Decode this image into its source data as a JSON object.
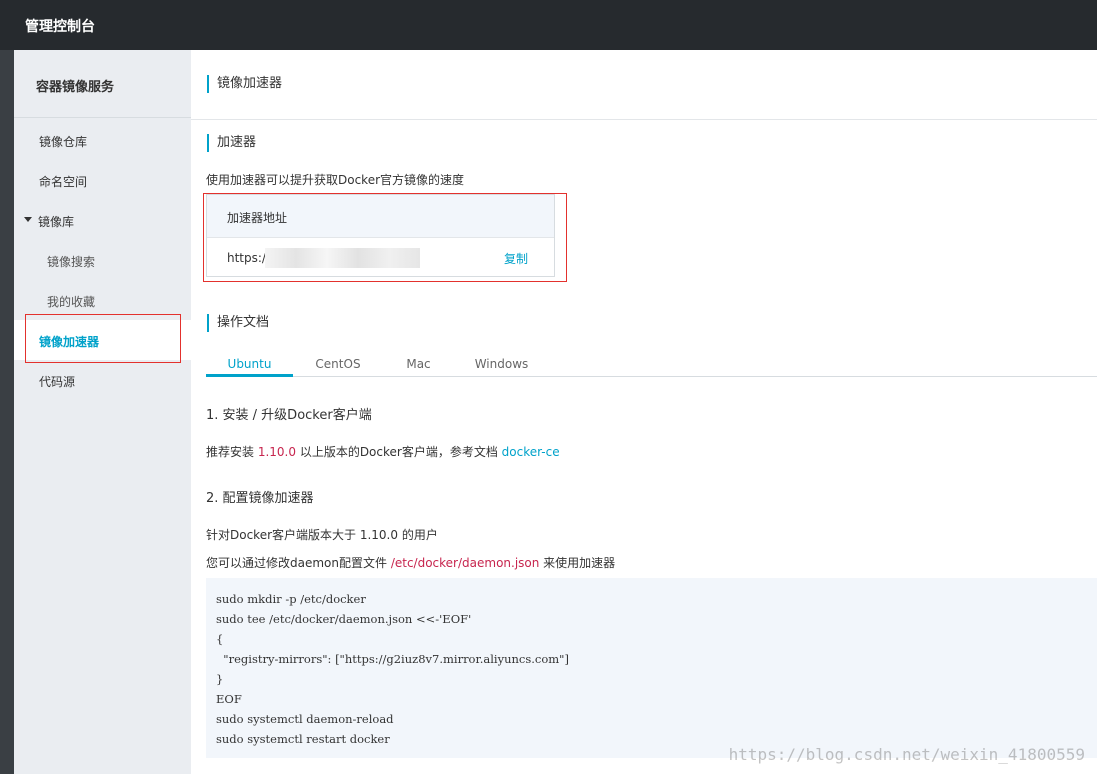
{
  "topbar": {
    "title": "管理控制台"
  },
  "sidebar": {
    "service_title": "容器镜像服务",
    "items": [
      {
        "label": "镜像仓库"
      },
      {
        "label": "命名空间"
      },
      {
        "label": "镜像库"
      },
      {
        "label": "镜像搜索"
      },
      {
        "label": "我的收藏"
      },
      {
        "label": "镜像加速器"
      },
      {
        "label": "代码源"
      }
    ]
  },
  "main": {
    "page_title": "镜像加速器",
    "accelerator": {
      "section_title": "加速器",
      "description": "使用加速器可以提升获取Docker官方镜像的速度",
      "box_header": "加速器地址",
      "url_prefix": "https://g",
      "copy_label": "复制"
    },
    "docs": {
      "section_title": "操作文档",
      "tabs": [
        "Ubuntu",
        "CentOS",
        "Mac",
        "Windows"
      ],
      "active_tab": "Ubuntu",
      "step1": {
        "title": "1. 安装 / 升级Docker客户端",
        "text_before": "推荐安装 ",
        "version": "1.10.0",
        "text_middle": " 以上版本的Docker客户端，参考文档 ",
        "link": "docker-ce"
      },
      "step2": {
        "title": "2. 配置镜像加速器",
        "line1": "针对Docker客户端版本大于 1.10.0 的用户",
        "line2_before": "您可以通过修改daemon配置文件 ",
        "line2_path": "/etc/docker/daemon.json",
        "line2_after": " 来使用加速器"
      },
      "code": "sudo mkdir -p /etc/docker\nsudo tee /etc/docker/daemon.json <<-'EOF'\n{\n  \"registry-mirrors\": [\"https://g2iuz8v7.mirror.aliyuncs.com\"]\n}\nEOF\nsudo systemctl daemon-reload\nsudo systemctl restart docker"
    }
  },
  "watermark": "https://blog.csdn.net/weixin_41800559",
  "colors": {
    "accent": "#00a2ca",
    "highlight_box": "#e3312d",
    "topbar": "#262a2e"
  }
}
